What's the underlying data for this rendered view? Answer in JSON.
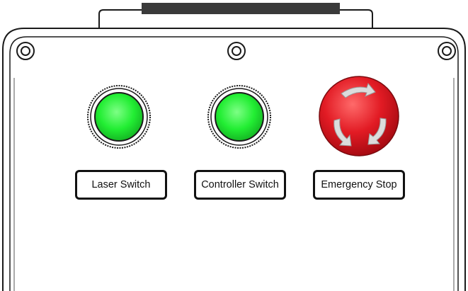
{
  "panel": {
    "buttons": [
      {
        "label": "Laser Switch",
        "color": "#22ee33",
        "kind": "push-button"
      },
      {
        "label": "Controller Switch",
        "color": "#22ee33",
        "kind": "push-button"
      },
      {
        "label": "Emergency Stop",
        "color": "#e21b24",
        "kind": "emergency-stop-mushroom"
      }
    ],
    "colors": {
      "outline": "#1a1a1a",
      "panel_fill": "#ffffff",
      "top_bar": "#3a3a3a",
      "arrow": "#d9d9d9"
    }
  }
}
